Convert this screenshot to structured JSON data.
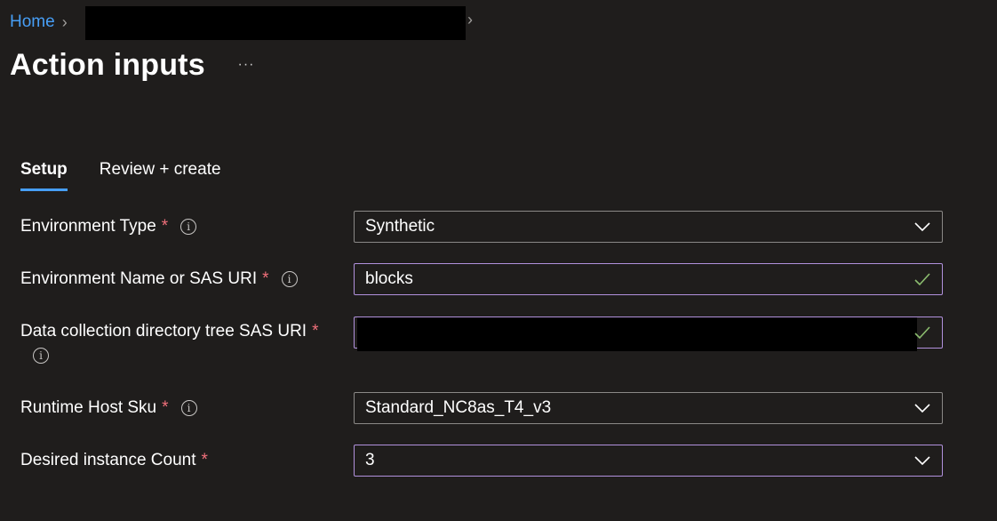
{
  "breadcrumb": {
    "home": "Home"
  },
  "page": {
    "title": "Action inputs",
    "more": "···"
  },
  "tabs": [
    {
      "label": "Setup"
    },
    {
      "label": "Review + create"
    }
  ],
  "form": {
    "environment_type": {
      "label": "Environment Type",
      "required": "*",
      "value": "Synthetic"
    },
    "environment_name": {
      "label": "Environment Name or SAS URI",
      "required": "*",
      "value": "blocks"
    },
    "data_collection": {
      "label": "Data collection directory tree SAS URI",
      "required": "*",
      "value": ""
    },
    "runtime_sku": {
      "label": "Runtime Host Sku",
      "required": "*",
      "value": "Standard_NC8as_T4_v3"
    },
    "instance_count": {
      "label": "Desired instance Count",
      "required": "*",
      "value": "3"
    }
  },
  "icons": {
    "info": "info-icon",
    "chevron_down": "chevron-down-icon",
    "check": "check-icon",
    "chevron_right": "chevron-right-icon"
  },
  "colors": {
    "background": "#1f1d1c",
    "link": "#479ef5",
    "required": "#f1707b",
    "focus_border": "#b191dc",
    "border": "#8a8886",
    "check": "#8cbd6f"
  }
}
